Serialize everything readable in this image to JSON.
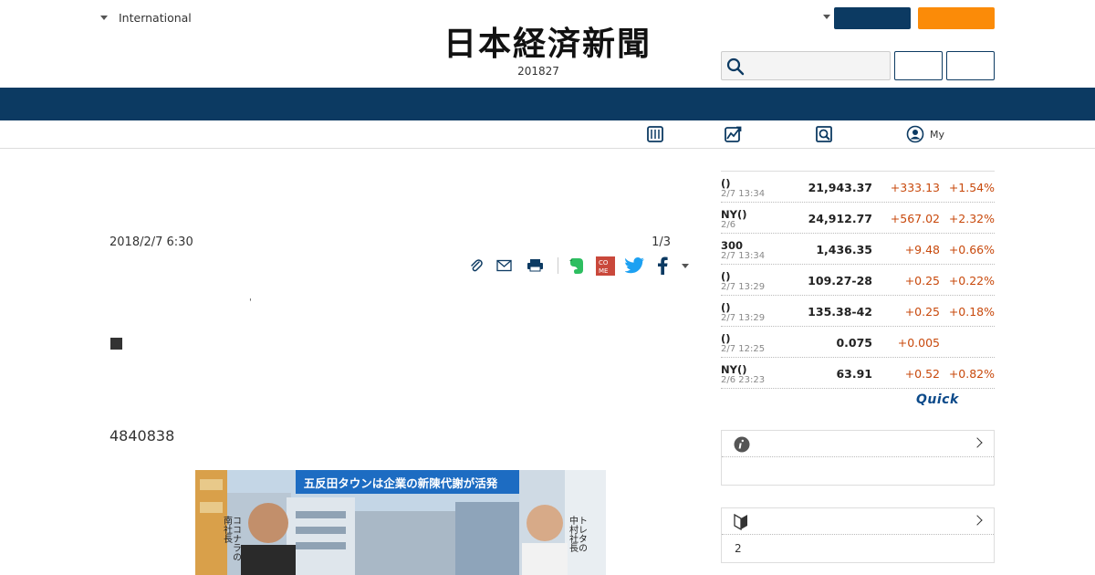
{
  "header": {
    "region_label": "International",
    "logo_text": "日本経済新聞",
    "edition": "201827",
    "search_placeholder": ""
  },
  "article": {
    "date": "2018/2/7 6:30",
    "page": "1/3",
    "tick": "'",
    "number_text": "4840838",
    "photo_caption": "五反田タウンは企業の新陳代謝が活発"
  },
  "subnav": {
    "my_label": "My"
  },
  "market": {
    "rows": [
      {
        "name": "()",
        "time": "2/7 13:34",
        "value": "21,943.37",
        "change": "+333.13",
        "percent": "+1.54%"
      },
      {
        "name": "NY()",
        "time": "2/6",
        "value": "24,912.77",
        "change": "+567.02",
        "percent": "+2.32%"
      },
      {
        "name": "300",
        "time": "2/7 13:34",
        "value": "1,436.35",
        "change": "+9.48",
        "percent": "+0.66%"
      },
      {
        "name": "()",
        "time": "2/7 13:29",
        "value": "109.27-28",
        "change": "+0.25",
        "percent": "+0.22%"
      },
      {
        "name": "()",
        "time": "2/7 13:29",
        "value": "135.38-42",
        "change": "+0.25",
        "percent": "+0.18%"
      },
      {
        "name": "()",
        "time": "2/7 12:25",
        "value": "0.075",
        "change": "+0.005",
        "percent": ""
      },
      {
        "name": "NY()",
        "time": "2/6 23:23",
        "value": "63.91",
        "change": "+0.52",
        "percent": "+0.82%"
      }
    ],
    "provider": "Quick"
  },
  "side_boxes": {
    "box1_body": "",
    "box2_body": "2"
  },
  "colors": {
    "navy": "#0c3a62",
    "orange": "#fb8b08",
    "positive": "#c8490c"
  }
}
